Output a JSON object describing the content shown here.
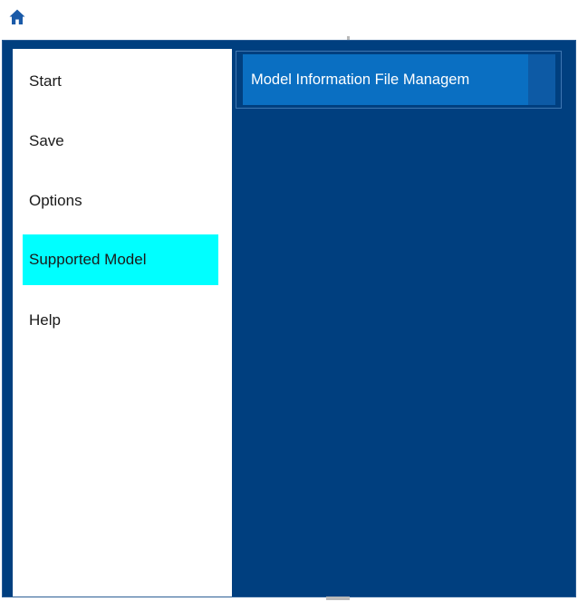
{
  "toolbar": {
    "home_icon": "home-icon",
    "home_icon_color": "#1a5aa8"
  },
  "backstage": {
    "background_color": "#003f7f",
    "menu": [
      {
        "label": "Start"
      },
      {
        "label": "Save"
      },
      {
        "label": "Options"
      },
      {
        "label": "Supported Model",
        "selected": true
      },
      {
        "label": "Help"
      }
    ],
    "selected_highlight_color": "#00ffff"
  },
  "content": {
    "tabs": [
      {
        "label": "Model Information File Managem",
        "active": true
      }
    ],
    "tab_color": "#0a6fc2"
  }
}
